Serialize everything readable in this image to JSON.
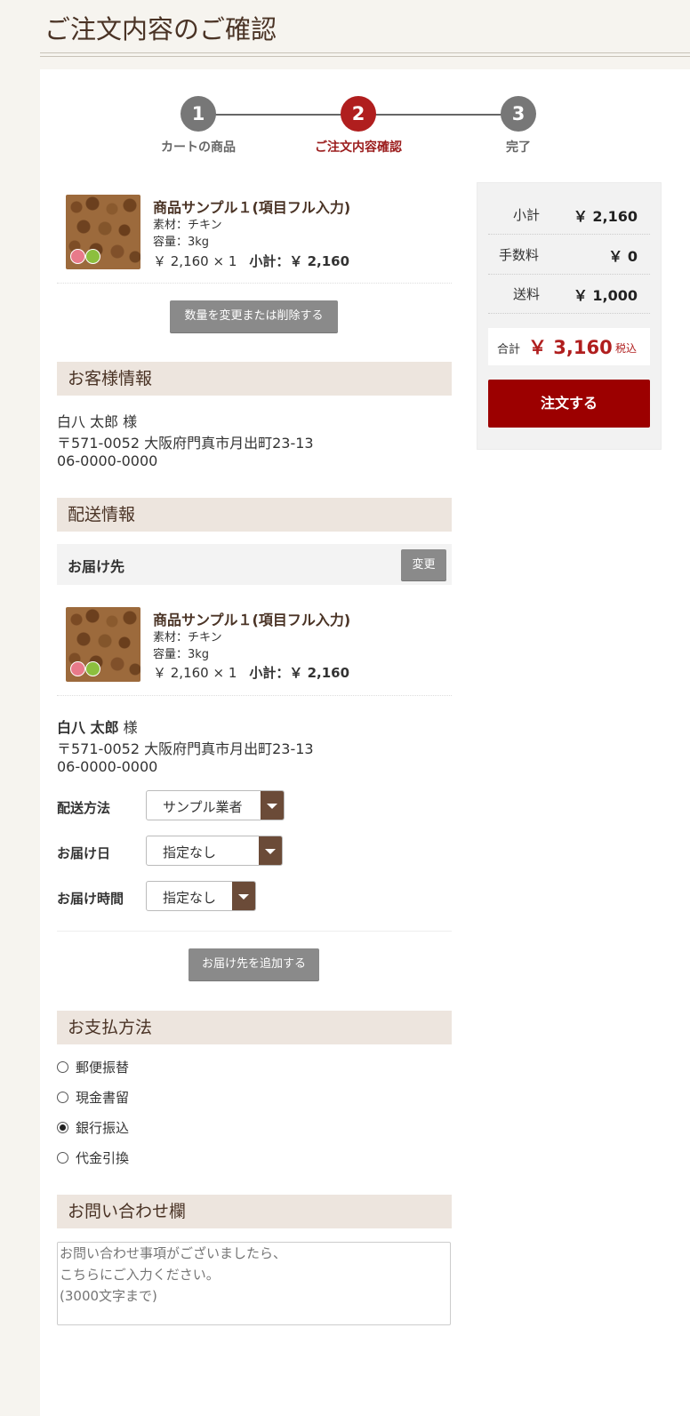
{
  "page_title": "ご注文内容のご確認",
  "steps": [
    {
      "num": "1",
      "label": "カートの商品"
    },
    {
      "num": "2",
      "label": "ご注文内容確認"
    },
    {
      "num": "3",
      "label": "完了"
    }
  ],
  "items": [
    {
      "name": "商品サンプル１(項目フル入力)",
      "spec1": "素材：チキン",
      "spec2": "容量：3kg",
      "price": "￥ 2,160 × 1",
      "subtotal": "小計：￥ 2,160"
    },
    {
      "name": "商品サンプル１(項目フル入力)",
      "spec1": "素材：チキン",
      "spec2": "容量：3kg",
      "price": "￥ 2,160 × 1",
      "subtotal": "小計：￥ 2,160"
    }
  ],
  "change_qty_button": "数量を変更または削除する",
  "customer": {
    "heading": "お客様情報",
    "name": "白八 太郎 様",
    "address": "〒571-0052 大阪府門真市月出町23-13",
    "phone": "06-0000-0000"
  },
  "delivery": {
    "heading": "配送情報",
    "dest_label": "お届け先",
    "change_button": "変更",
    "name_bold": "白八 太郎",
    "name_suffix": " 様",
    "address": "〒571-0052 大阪府門真市月出町23-13",
    "phone": "06-0000-0000",
    "method_label": "配送方法",
    "method_value": "サンプル業者",
    "date_label": "お届け日",
    "date_value": "指定なし",
    "time_label": "お届け時間",
    "time_value": "指定なし",
    "add_dest_button": "お届け先を追加する"
  },
  "payment": {
    "heading": "お支払方法",
    "options": [
      "郵便振替",
      "現金書留",
      "銀行振込",
      "代金引換"
    ],
    "selected_index": 2
  },
  "inquiry": {
    "heading": "お問い合わせ欄",
    "placeholder": "お問い合わせ事項がございましたら、\nこちらにご入力ください。\n(3000文字まで)"
  },
  "summary": {
    "subtotal_label": "小計",
    "subtotal_value": "￥ 2,160",
    "fee_label": "手数料",
    "fee_value": "￥ 0",
    "shipping_label": "送料",
    "shipping_value": "￥ 1,000",
    "total_label": "合計",
    "total_value": "￥ 3,160",
    "tax_label": "税込",
    "order_button": "注文する"
  },
  "colors": {
    "accent_red": "#b01e1e",
    "order_button": "#9c0000",
    "select_arrow": "#6b4b38",
    "section_bg": "#ede5de"
  }
}
